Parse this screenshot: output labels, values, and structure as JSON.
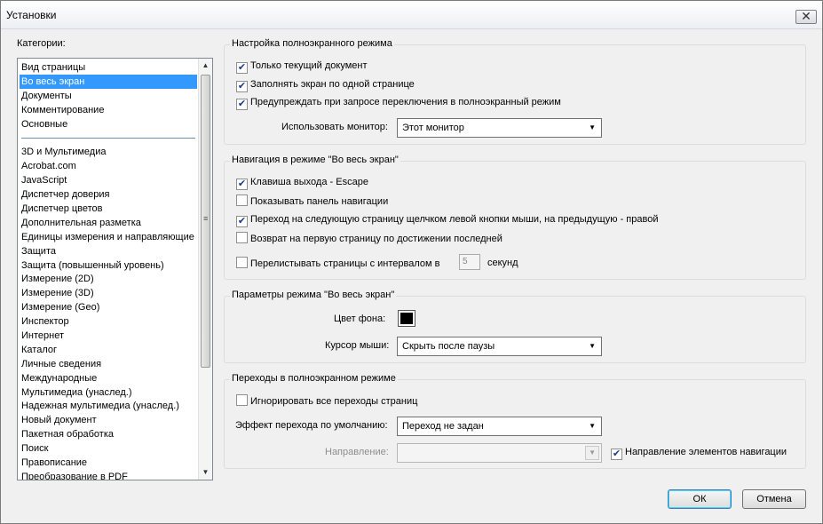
{
  "window": {
    "title": "Установки",
    "close_glyph": "✕"
  },
  "categories": {
    "label": "Категории:",
    "top_items": [
      "Вид страницы",
      "Во весь экран",
      "Документы",
      "Комментирование",
      "Основные"
    ],
    "selected": "Во весь экран",
    "items": [
      "3D и Мультимедиа",
      "Acrobat.com",
      "JavaScript",
      "Диспетчер доверия",
      "Диспетчер цветов",
      "Дополнительная разметка",
      "Единицы измерения и направляющие",
      "Защита",
      "Защита (повышенный уровень)",
      "Измерение (2D)",
      "Измерение (3D)",
      "Измерение (Geo)",
      "Инспектор",
      "Интернет",
      "Каталог",
      "Личные сведения",
      "Международные",
      "Мультимедиа (унаслед.)",
      "Надежная мультимедиа (унаслед.)",
      "Новый документ",
      "Пакетная обработка",
      "Поиск",
      "Правописание",
      "Преобразование в PDF"
    ]
  },
  "fullscreen_setup": {
    "title": "Настройка полноэкранного режима",
    "current_doc_only": {
      "label": "Только текущий документ",
      "checked": true
    },
    "fill_screen": {
      "label": "Заполнять экран по одной странице",
      "checked": true
    },
    "warn_on_switch": {
      "label": "Предупреждать при запросе переключения в полноэкранный режим",
      "checked": true
    },
    "monitor_label": "Использовать монитор:",
    "monitor_value": "Этот монитор"
  },
  "navigation": {
    "title": "Навигация в режиме \"Во весь экран\"",
    "escape_exit": {
      "label": "Клавиша выхода - Escape",
      "checked": true
    },
    "show_nav_bar": {
      "label": "Показывать панель навигации",
      "checked": false
    },
    "click_advance": {
      "label": "Переход на следующую страницу щелчком левой кнопки мыши, на предыдущую - правой",
      "checked": true
    },
    "loop_after_last": {
      "label": "Возврат на первую страницу по достижении последней",
      "checked": false
    },
    "advance_interval": {
      "label": "Перелистывать страницы с интервалом в",
      "checked": false,
      "value": "5",
      "unit": "секунд"
    }
  },
  "appearance": {
    "title": "Параметры режима \"Во весь экран\"",
    "bg_color_label": "Цвет фона:",
    "bg_color": "#000000",
    "cursor_label": "Курсор мыши:",
    "cursor_value": "Скрыть после паузы"
  },
  "transitions": {
    "title": "Переходы в полноэкранном режиме",
    "ignore_all": {
      "label": "Игнорировать все переходы страниц",
      "checked": false
    },
    "default_effect_label": "Эффект перехода по умолчанию:",
    "default_effect_value": "Переход не задан",
    "direction_label": "Направление:",
    "direction_value": "",
    "nav_direction": {
      "label": "Направление элементов навигации",
      "checked": true
    }
  },
  "buttons": {
    "ok": "ОК",
    "cancel": "Отмена"
  },
  "colors": {
    "selection": "#3399ff",
    "dialog_bg": "#f0f0f0"
  }
}
